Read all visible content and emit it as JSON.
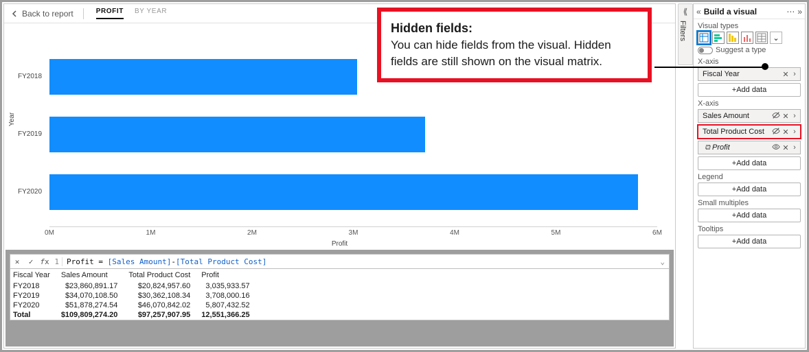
{
  "back_label": "Back to report",
  "tabs": {
    "profit": "PROFIT",
    "by_year": "BY YEAR"
  },
  "chart_data": {
    "type": "bar",
    "orientation": "horizontal",
    "title": "",
    "ylabel": "Year",
    "xlabel": "Profit",
    "categories": [
      "FY2018",
      "FY2019",
      "FY2020"
    ],
    "values": [
      3035933.57,
      3708000.16,
      5807432.52
    ],
    "xlim": [
      0,
      6000000
    ],
    "x_ticks": [
      "0M",
      "1M",
      "2M",
      "3M",
      "4M",
      "5M",
      "6M"
    ],
    "bar_color": "#118DFF"
  },
  "formula": {
    "index": "1",
    "measure": "Profit",
    "col1": "[Sales Amount]",
    "col2": "[Total Product Cost]",
    "raw": "Profit = [Sales Amount]-[Total Product Cost]"
  },
  "table": {
    "headers": [
      "Fiscal Year",
      "Sales Amount",
      "Total Product Cost",
      "Profit"
    ],
    "rows": [
      [
        "FY2018",
        "$23,860,891.17",
        "$20,824,957.60",
        "3,035,933.57"
      ],
      [
        "FY2019",
        "$34,070,108.50",
        "$30,362,108.34",
        "3,708,000.16"
      ],
      [
        "FY2020",
        "$51,878,274.54",
        "$46,070,842.02",
        "5,807,432.52"
      ]
    ],
    "total": [
      "Total",
      "$109,809,274.20",
      "$97,257,907.95",
      "12,551,366.25"
    ]
  },
  "filters_label": "Filters",
  "pane": {
    "title": "Build a visual",
    "visual_types_label": "Visual types",
    "suggest": "Suggest a type",
    "field_wells": {
      "xaxis1": {
        "label": "X-axis",
        "fields": [
          {
            "name": "Fiscal Year",
            "hidden": false,
            "measure": false
          }
        ],
        "add": "+Add data"
      },
      "xaxis2": {
        "label": "X-axis",
        "fields": [
          {
            "name": "Sales Amount",
            "hidden": true,
            "measure": false
          },
          {
            "name": "Total Product Cost",
            "hidden": true,
            "measure": false
          },
          {
            "name": "Profit",
            "hidden": false,
            "measure": true
          }
        ],
        "add": "+Add data"
      },
      "legend": {
        "label": "Legend",
        "add": "+Add data"
      },
      "small": {
        "label": "Small multiples",
        "add": "+Add data"
      },
      "tooltips": {
        "label": "Tooltips",
        "add": "+Add data"
      }
    }
  },
  "callout": {
    "title": "Hidden fields:",
    "body": "You can hide fields from the visual. Hidden fields are still shown on the visual matrix."
  }
}
